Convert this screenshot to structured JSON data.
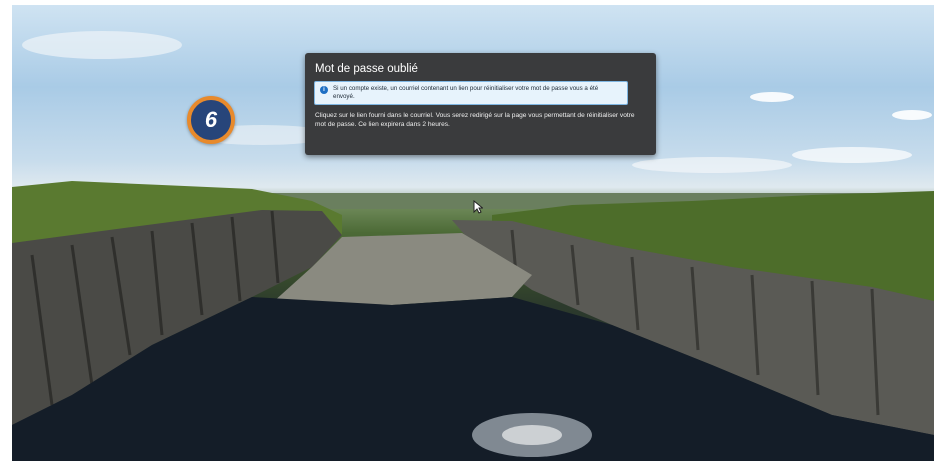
{
  "badge": {
    "number": "6"
  },
  "dialog": {
    "title": "Mot de passe oublié",
    "info_icon": "info-icon",
    "info_message": "Si un compte existe, un courriel contenant un lien pour réinitialiser votre mot de passe vous a été envoyé.",
    "body": "Cliquez sur le lien fourni dans le courriel. Vous serez redirigé sur la page vous permettant de réinitialiser votre mot de passe. Ce lien expirera dans 2 heures."
  },
  "colors": {
    "badge_fill": "#27457a",
    "badge_ring": "#e88a2c",
    "dialog_bg": "#3a3b3d",
    "info_bg": "#e7f3fc",
    "info_accent": "#1d6fc4"
  }
}
